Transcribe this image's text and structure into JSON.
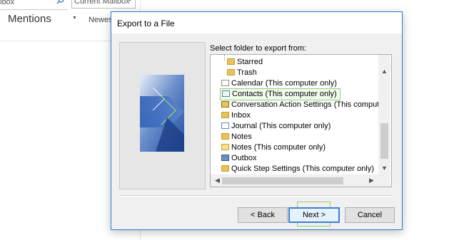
{
  "background": {
    "search_text": "lbox",
    "scope_label": "Current Mailbox",
    "mentions_label": "Mentions",
    "sort_label": "Newest"
  },
  "dialog": {
    "title": "Export to a File",
    "folder_prompt": "Select folder to export from:",
    "folders": [
      {
        "label": "Starred",
        "icon": "folder-icon"
      },
      {
        "label": "Trash",
        "icon": "folder-icon"
      },
      {
        "label": "Calendar (This computer only)",
        "icon": "calendar-icon"
      },
      {
        "label": "Contacts (This computer only)",
        "icon": "contacts-icon",
        "selected": true
      },
      {
        "label": "Conversation Action Settings (This computer only)",
        "icon": "settings-folder-icon"
      },
      {
        "label": "Inbox",
        "icon": "folder-icon"
      },
      {
        "label": "Journal (This computer only)",
        "icon": "journal-icon"
      },
      {
        "label": "Notes",
        "icon": "folder-icon"
      },
      {
        "label": "Notes (This computer only)",
        "icon": "notes-icon"
      },
      {
        "label": "Outbox",
        "icon": "outbox-icon"
      },
      {
        "label": "Quick Step Settings (This computer only)",
        "icon": "folder-icon"
      }
    ],
    "buttons": {
      "back": "< Back",
      "next": "Next >",
      "cancel": "Cancel"
    }
  },
  "colors": {
    "dialog_border": "#2b7bd0",
    "selection_highlight": "#8dd06f",
    "default_button_border": "#3b7fd4"
  }
}
